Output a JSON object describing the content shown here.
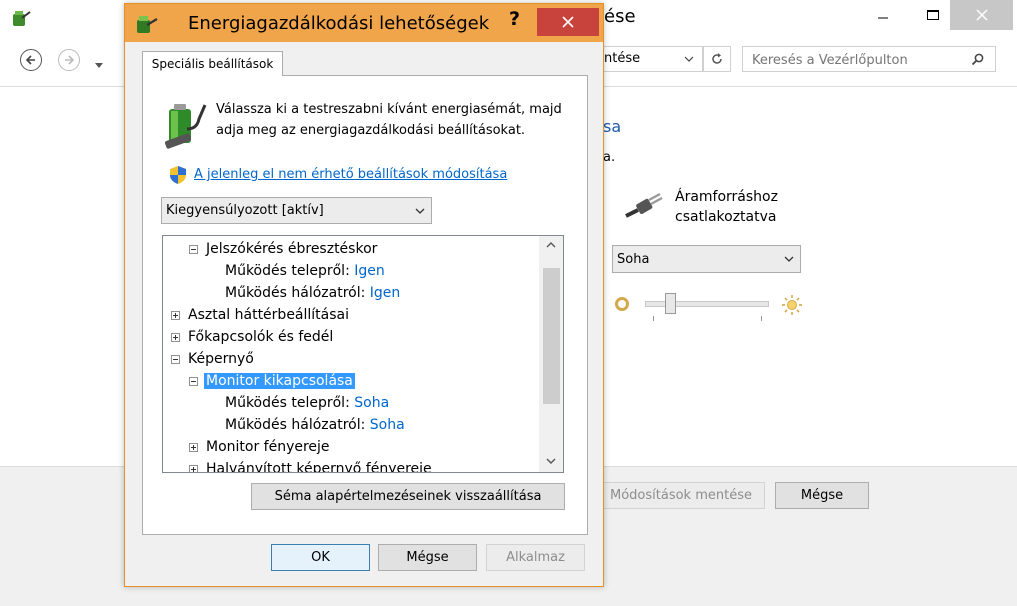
{
  "background_window": {
    "title_fragment": "ése",
    "address_fragment": "ntése",
    "search_placeholder": "Keresés a Vezérlőpulton",
    "heading_fragment": "sa",
    "text_fragment": "a.",
    "plugged_in_label_line1": "Áramforráshoz",
    "plugged_in_label_line2": "csatlakoztatva",
    "display_off_select": "Soha",
    "brightness_level": 0.18,
    "save_button": "Módosítások mentése",
    "cancel_button": "Mégse"
  },
  "dialog": {
    "title": "Energiagazdálkodási lehetőségek",
    "help_glyph": "?",
    "tab_label": "Speciális beállítások",
    "intro_line1": "Válassza ki a testreszabni kívánt energiasémát, majd",
    "intro_line2": "adja meg az energiagazdálkodási beállításokat.",
    "change_link": "A jelenleg el nem érhető beállítások módosítása",
    "plan_select": "Kiegyensúlyozott [aktív]",
    "tree": [
      {
        "label": "Jelszókérés ébresztéskor",
        "value": ""
      },
      {
        "label": "Működés telepről: ",
        "value": "Igen"
      },
      {
        "label": "Működés hálózatról: ",
        "value": "Igen"
      },
      {
        "label": "Asztal háttérbeállításai",
        "value": ""
      },
      {
        "label": "Főkapcsolók és fedél",
        "value": ""
      },
      {
        "label": "Képernyő",
        "value": ""
      },
      {
        "label": "Monitor kikapcsolása",
        "value": ""
      },
      {
        "label": "Működés telepről: ",
        "value": "Soha"
      },
      {
        "label": "Működés hálózatról: ",
        "value": "Soha"
      },
      {
        "label": "Monitor fényereje",
        "value": ""
      },
      {
        "label": "Halványított képernyő fényereje",
        "value": ""
      }
    ],
    "restore_button": "Séma alapértelmezéseinek visszaállítása",
    "ok_button": "OK",
    "cancel_button": "Mégse",
    "apply_button": "Alkalmaz"
  },
  "colors": {
    "dialog_frame": "#f0a54b",
    "close_red": "#c7433b",
    "selection": "#3399ff",
    "link": "#0066cc"
  }
}
